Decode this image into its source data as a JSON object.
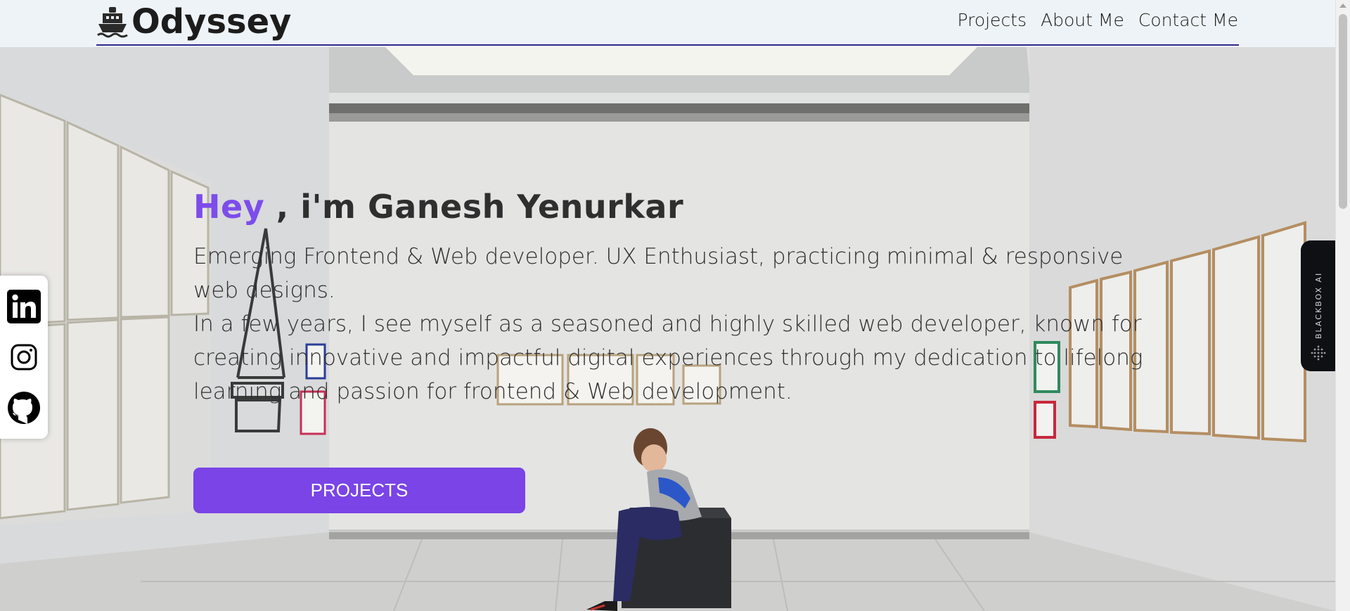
{
  "brand": {
    "name": "Odyssey",
    "logo_icon": "ship-icon"
  },
  "nav": {
    "items": [
      "Projects",
      "About Me",
      "Contact Me"
    ]
  },
  "hero": {
    "greeting": "Hey",
    "title_rest": " , i'm Ganesh Yenurkar",
    "description_1": "Emerging Frontend & Web developer. UX Enthusiast, practicing minimal & responsive web designs.",
    "description_2": "In a few years, I see myself as a seasoned and highly skilled web developer, known for creating innovative and impactful digital experiences through my dedication to lifelong learning and passion for frontend & Web development.",
    "cta_label": "PROJECTS"
  },
  "social": {
    "icons": [
      "linkedin-icon",
      "instagram-icon",
      "github-icon"
    ]
  },
  "side_widget": {
    "label": "BLACKBOX AI"
  },
  "colors": {
    "accent": "#7a44e6",
    "header_line": "#2e2a8a",
    "header_bg": "#eef3f7"
  }
}
